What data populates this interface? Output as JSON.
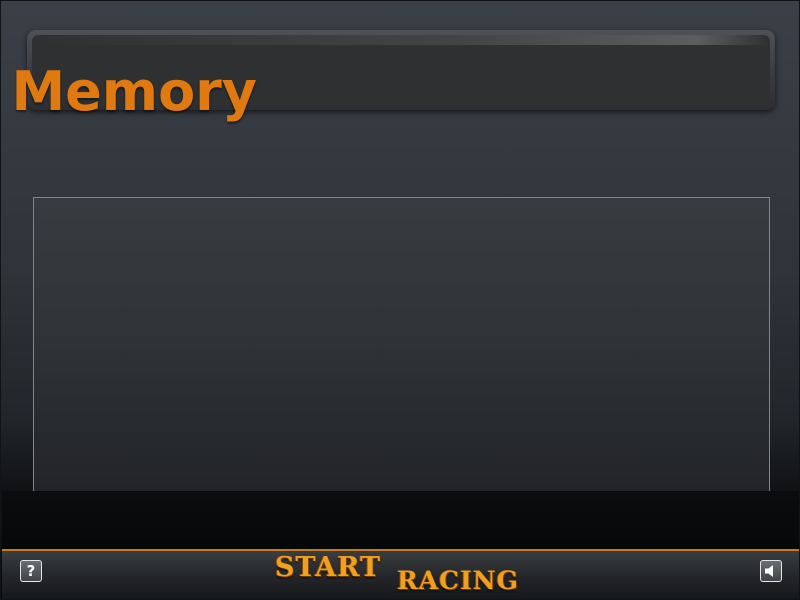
{
  "header": {
    "title": "a Memory"
  },
  "footer": {
    "help_label": "?",
    "logo_word1": "START",
    "logo_word2": "RACING"
  },
  "icons": {
    "help": "question-mark-icon",
    "sound": "speaker-icon"
  },
  "colors": {
    "accent": "#e07a10",
    "border_accent": "#c47a18",
    "background": "#2f3439"
  }
}
